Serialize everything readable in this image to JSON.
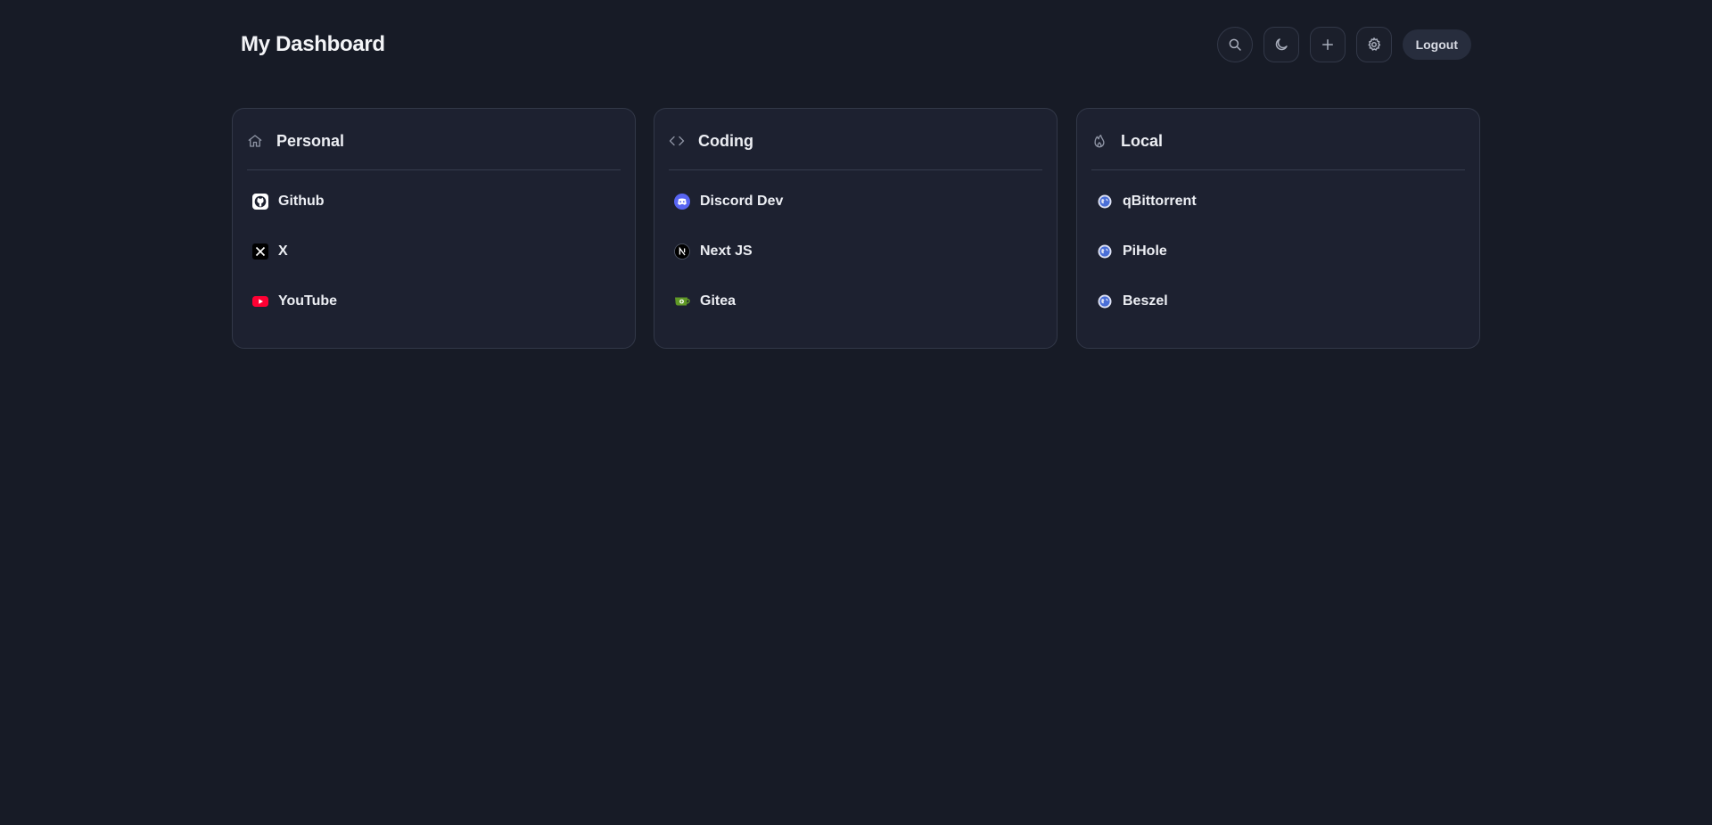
{
  "header": {
    "title": "My Dashboard",
    "logout_label": "Logout",
    "actions": [
      "search-icon",
      "moon-icon",
      "plus-icon",
      "gear-icon"
    ]
  },
  "colors": {
    "background": "#171b26",
    "card": "#1d2130",
    "border": "#323848",
    "text": "#eceef3"
  },
  "categories": [
    {
      "title": "Personal",
      "icon": "home-icon",
      "links": [
        {
          "label": "Github",
          "icon": "github-icon"
        },
        {
          "label": "X",
          "icon": "x-icon"
        },
        {
          "label": "YouTube",
          "icon": "youtube-icon"
        }
      ]
    },
    {
      "title": "Coding",
      "icon": "code-icon",
      "links": [
        {
          "label": "Discord Dev",
          "icon": "discord-icon"
        },
        {
          "label": "Next JS",
          "icon": "nextjs-icon"
        },
        {
          "label": "Gitea",
          "icon": "gitea-icon"
        }
      ]
    },
    {
      "title": "Local",
      "icon": "flame-icon",
      "links": [
        {
          "label": "qBittorrent",
          "icon": "globe-icon"
        },
        {
          "label": "PiHole",
          "icon": "globe-icon"
        },
        {
          "label": "Beszel",
          "icon": "globe-icon"
        }
      ]
    }
  ]
}
